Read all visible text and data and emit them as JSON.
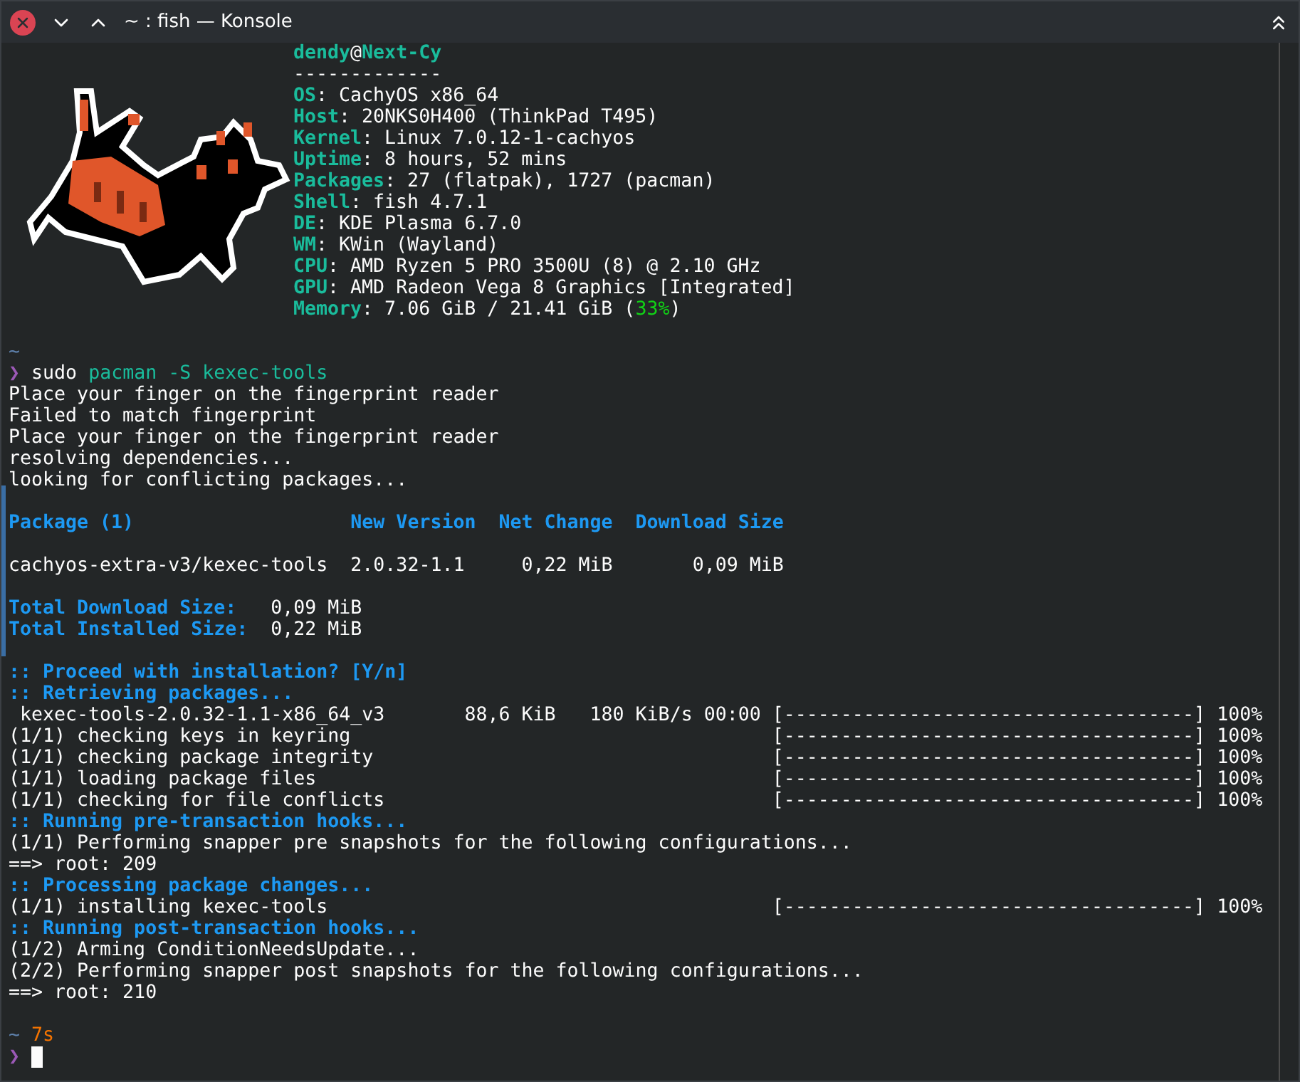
{
  "window": {
    "title": "~ : fish — Konsole"
  },
  "fetch": {
    "user": "dendy",
    "at": "@",
    "host": "Next-Cy",
    "separator": "-------------",
    "fields": [
      {
        "key": "OS",
        "value": ": CachyOS x86_64"
      },
      {
        "key": "Host",
        "value": ": 20NKS0H400 (ThinkPad T495)"
      },
      {
        "key": "Kernel",
        "value": ": Linux 7.0.12-1-cachyos"
      },
      {
        "key": "Uptime",
        "value": ": 8 hours, 52 mins"
      },
      {
        "key": "Packages",
        "value": ": 27 (flatpak), 1727 (pacman)"
      },
      {
        "key": "Shell",
        "value": ": fish 4.7.1"
      },
      {
        "key": "DE",
        "value": ": KDE Plasma 6.7.0"
      },
      {
        "key": "WM",
        "value": ": KWin (Wayland)"
      },
      {
        "key": "CPU",
        "value": ": AMD Ryzen 5 PRO 3500U (8) @ 2.10 GHz"
      },
      {
        "key": "GPU",
        "value": ": AMD Radeon Vega 8 Graphics [Integrated]"
      },
      {
        "key": "Memory",
        "value": ": 7.06 GiB / 21.41 GiB (",
        "percent": "33%",
        "closing": ")"
      }
    ]
  },
  "lines": [
    {
      "kind": "blank"
    },
    {
      "kind": "path",
      "text": "~"
    },
    {
      "kind": "command",
      "prompt": "❯",
      "command": "sudo",
      "args": "pacman -S kexec-tools"
    },
    {
      "kind": "output",
      "text": "Place your finger on the fingerprint reader"
    },
    {
      "kind": "output",
      "text": "Failed to match fingerprint"
    },
    {
      "kind": "output",
      "text": "Place your finger on the fingerprint reader"
    },
    {
      "kind": "output",
      "text": "resolving dependencies..."
    },
    {
      "kind": "output",
      "text": "looking for conflicting packages..."
    },
    {
      "kind": "blank"
    },
    {
      "kind": "heading",
      "text": "Package (1)                   New Version  Net Change  Download Size"
    },
    {
      "kind": "blank"
    },
    {
      "kind": "output",
      "text": "cachyos-extra-v3/kexec-tools  2.0.32-1.1     0,22 MiB       0,09 MiB"
    },
    {
      "kind": "blank"
    },
    {
      "kind": "total",
      "label": "Total Download Size:",
      "value": "0,09 MiB"
    },
    {
      "kind": "total",
      "label": "Total Installed Size:",
      "value": "0,22 MiB"
    },
    {
      "kind": "blank"
    },
    {
      "kind": "heading",
      "text": ":: Proceed with installation? [Y/n]"
    },
    {
      "kind": "heading",
      "text": ":: Retrieving packages..."
    },
    {
      "kind": "progress",
      "label": " kexec-tools-2.0.32-1.1-x86_64_v3       88,6 KiB   180 KiB/s 00:00",
      "bar": "[------------------------------------]",
      "percent": "100%"
    },
    {
      "kind": "progress",
      "label": "(1/1) checking keys in keyring",
      "bar": "[------------------------------------]",
      "percent": "100%"
    },
    {
      "kind": "progress",
      "label": "(1/1) checking package integrity",
      "bar": "[------------------------------------]",
      "percent": "100%"
    },
    {
      "kind": "progress",
      "label": "(1/1) loading package files",
      "bar": "[------------------------------------]",
      "percent": "100%"
    },
    {
      "kind": "progress",
      "label": "(1/1) checking for file conflicts",
      "bar": "[------------------------------------]",
      "percent": "100%"
    },
    {
      "kind": "heading",
      "text": ":: Running pre-transaction hooks..."
    },
    {
      "kind": "output",
      "text": "(1/1) Performing snapper pre snapshots for the following configurations..."
    },
    {
      "kind": "output",
      "text": "==> root: 209"
    },
    {
      "kind": "heading",
      "text": ":: Processing package changes..."
    },
    {
      "kind": "progress",
      "label": "(1/1) installing kexec-tools",
      "bar": "[------------------------------------]",
      "percent": "100%"
    },
    {
      "kind": "heading",
      "text": ":: Running post-transaction hooks..."
    },
    {
      "kind": "output",
      "text": "(1/2) Arming ConditionNeedsUpdate..."
    },
    {
      "kind": "output",
      "text": "(2/2) Performing snapper post snapshots for the following configurations..."
    },
    {
      "kind": "output",
      "text": "==> root: 210"
    },
    {
      "kind": "blank"
    },
    {
      "kind": "status",
      "path": "~",
      "duration": "7s"
    },
    {
      "kind": "input",
      "prompt": "❯",
      "cursor": true
    }
  ]
}
